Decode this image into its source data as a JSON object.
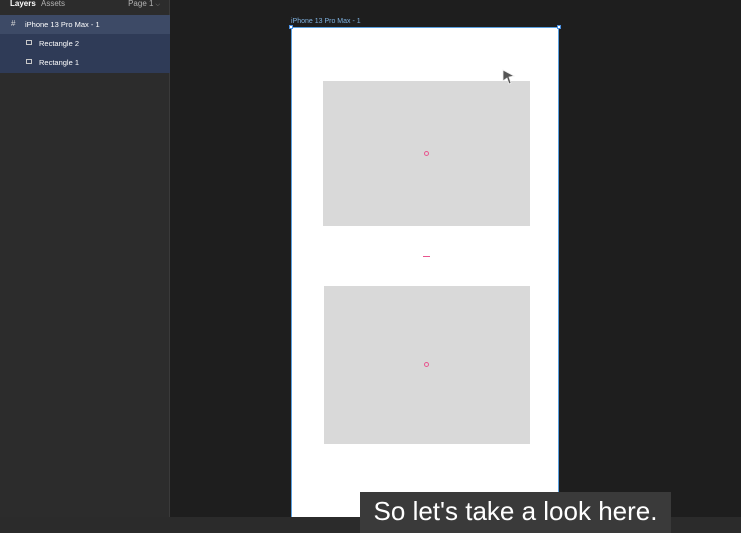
{
  "sidebar": {
    "tabs": [
      {
        "label": "Layers",
        "active": true
      },
      {
        "label": "Assets",
        "active": false
      }
    ],
    "page_selector": "Page 1",
    "layers": [
      {
        "label": "iPhone 13 Pro Max - 1",
        "icon": "frame-icon"
      },
      {
        "label": "Rectangle 2",
        "icon": "rectangle-icon"
      },
      {
        "label": "Rectangle 1",
        "icon": "rectangle-icon"
      }
    ]
  },
  "canvas": {
    "frame_label": "iPhone 13 Pro Max - 1"
  },
  "caption": "So let's take a look here.",
  "colors": {
    "selection": "#4a90e2",
    "center_marker": "#e8578f",
    "rectangle_fill": "#d9d9d9",
    "layer_highlight": "#3d4a66"
  }
}
